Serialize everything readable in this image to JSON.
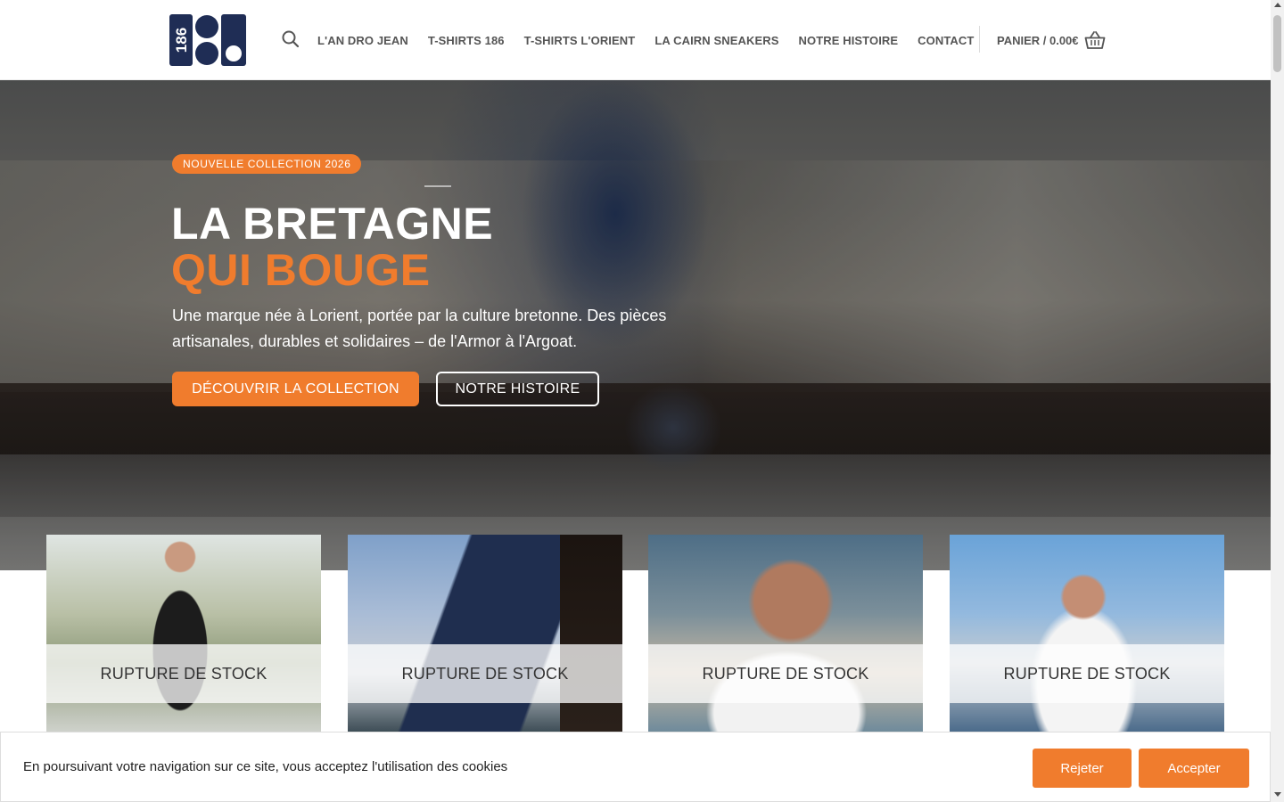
{
  "header": {
    "logo_text": "186",
    "nav": [
      {
        "label": "L'AN DRO JEAN"
      },
      {
        "label": "T-SHIRTS 186"
      },
      {
        "label": "T-SHIRTS L'ORIENT"
      },
      {
        "label": "LA CAIRN SNEAKERS"
      },
      {
        "label": "NOTRE HISTOIRE"
      },
      {
        "label": "CONTACT"
      }
    ],
    "cart_label": "PANIER / 0.00€",
    "icons": {
      "search": "search-icon",
      "cart": "basket-icon"
    }
  },
  "hero": {
    "badge": "NOUVELLE COLLECTION 2026",
    "title_line1": "LA BRETAGNE",
    "title_line2": "QUI BOUGE",
    "description": "Une marque née à Lorient, portée par la culture bretonne. Des pièces artisanales, durables et solidaires – de l'Armor à l'Argoat.",
    "cta_primary": "DÉCOUVRIR LA COLLECTION",
    "cta_secondary": "NOTRE HISTOIRE"
  },
  "products": [
    {
      "status": "RUPTURE DE STOCK"
    },
    {
      "status": "RUPTURE DE STOCK"
    },
    {
      "status": "RUPTURE DE STOCK"
    },
    {
      "status": "RUPTURE DE STOCK"
    }
  ],
  "cookie": {
    "message": "En poursuivant votre navigation sur ce site, vous acceptez l'utilisation des cookies",
    "reject_label": "Rejeter",
    "accept_label": "Accepter"
  },
  "colors": {
    "accent": "#f07c2d",
    "logo_navy": "#1f2d55"
  }
}
